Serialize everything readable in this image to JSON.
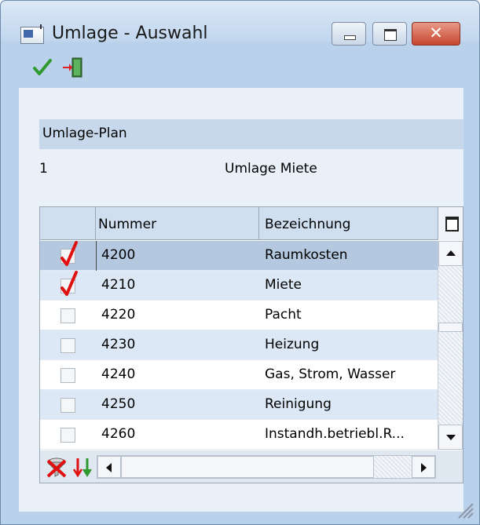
{
  "window": {
    "title": "Umlage - Auswahl",
    "close_label": "✕"
  },
  "toolbar": {
    "confirm_icon": "green-checkmark-icon",
    "exit_icon": "exit-door-icon"
  },
  "plan": {
    "header": "Umlage-Plan",
    "number": "1",
    "name": "Umlage Miete"
  },
  "table": {
    "columns": {
      "nummer": "Nummer",
      "bezeichnung": "Bezeichnung"
    },
    "rows": [
      {
        "checked": true,
        "nummer": "4200",
        "bezeichnung": "Raumkosten"
      },
      {
        "checked": true,
        "nummer": "4210",
        "bezeichnung": "Miete"
      },
      {
        "checked": false,
        "nummer": "4220",
        "bezeichnung": "Pacht"
      },
      {
        "checked": false,
        "nummer": "4230",
        "bezeichnung": "Heizung"
      },
      {
        "checked": false,
        "nummer": "4240",
        "bezeichnung": "Gas, Strom, Wasser"
      },
      {
        "checked": false,
        "nummer": "4250",
        "bezeichnung": "Reinigung"
      },
      {
        "checked": false,
        "nummer": "4260",
        "bezeichnung": "Instandh.betriebl.R..."
      }
    ]
  },
  "colors": {
    "accent_red": "#e01010",
    "row_alt": "#dce8f6",
    "selected_row": "#b4c8e0"
  }
}
